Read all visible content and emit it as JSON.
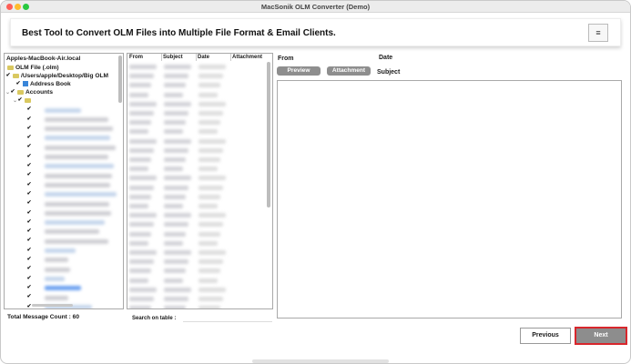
{
  "window": {
    "title": "MacSonik OLM Converter (Demo)"
  },
  "banner": {
    "text": "Best Tool to Convert OLM Files into Multiple File Format & Email Clients.",
    "menu_icon": "menu-icon"
  },
  "tree": {
    "root": "Apples-MacBook-Air.local",
    "olm_label": "OLM File (.olm)",
    "path": "/Users/apple/Desktop/Big OLM",
    "address_book": "Address Book",
    "accounts": "Accounts"
  },
  "table": {
    "headers": [
      "From",
      "Subject",
      "Date",
      "Attachment"
    ]
  },
  "preview": {
    "from_label": "From",
    "date_label": "Date",
    "subject_label": "Subject",
    "preview_tab": "Preview",
    "attachment_tab": "Attachment"
  },
  "footer": {
    "count_text": "Total Message Count : 60",
    "search_label": "Search on table :",
    "search_value": ""
  },
  "buttons": {
    "previous": "Previous",
    "next": "Next"
  },
  "colors": {
    "accent_border": "#d8262c",
    "button_gray": "#8d8d8d"
  }
}
